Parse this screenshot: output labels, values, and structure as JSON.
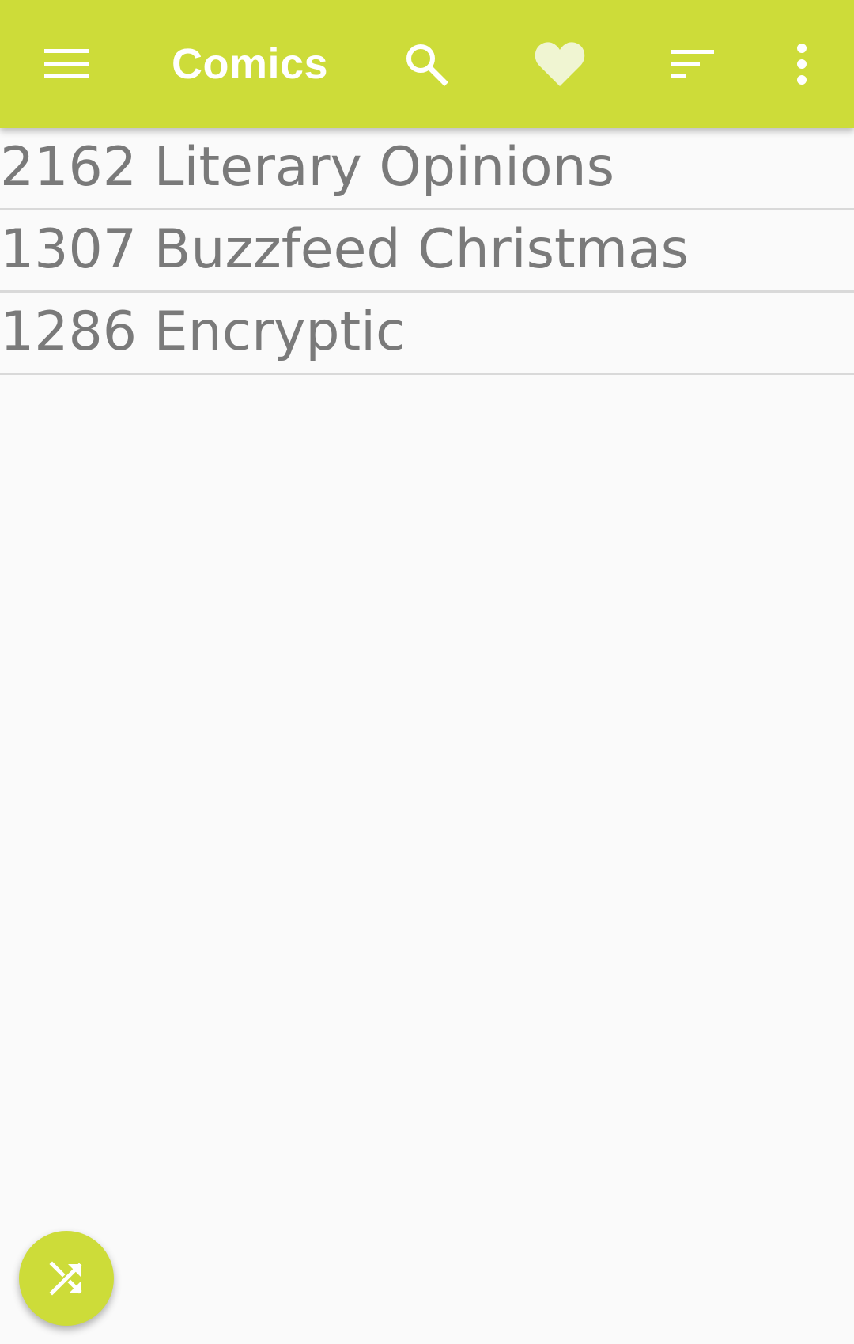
{
  "colors": {
    "toolbar": "#cddc39",
    "toolbar_text": "#ffffff",
    "heart": "#f0f5d2",
    "row_text": "#7a7a7a",
    "divider": "#d9d9d9",
    "fab": "#cddc39",
    "background": "#fafafa"
  },
  "toolbar": {
    "title": "Comics",
    "icons": [
      "menu-icon",
      "search-icon",
      "heart-icon",
      "sort-icon",
      "more-vert-icon"
    ]
  },
  "comics": [
    {
      "label": "2162 Literary Opinions"
    },
    {
      "label": "1307 Buzzfeed Christmas"
    },
    {
      "label": "1286 Encryptic"
    }
  ],
  "fab": {
    "icon": "shuffle-icon"
  }
}
